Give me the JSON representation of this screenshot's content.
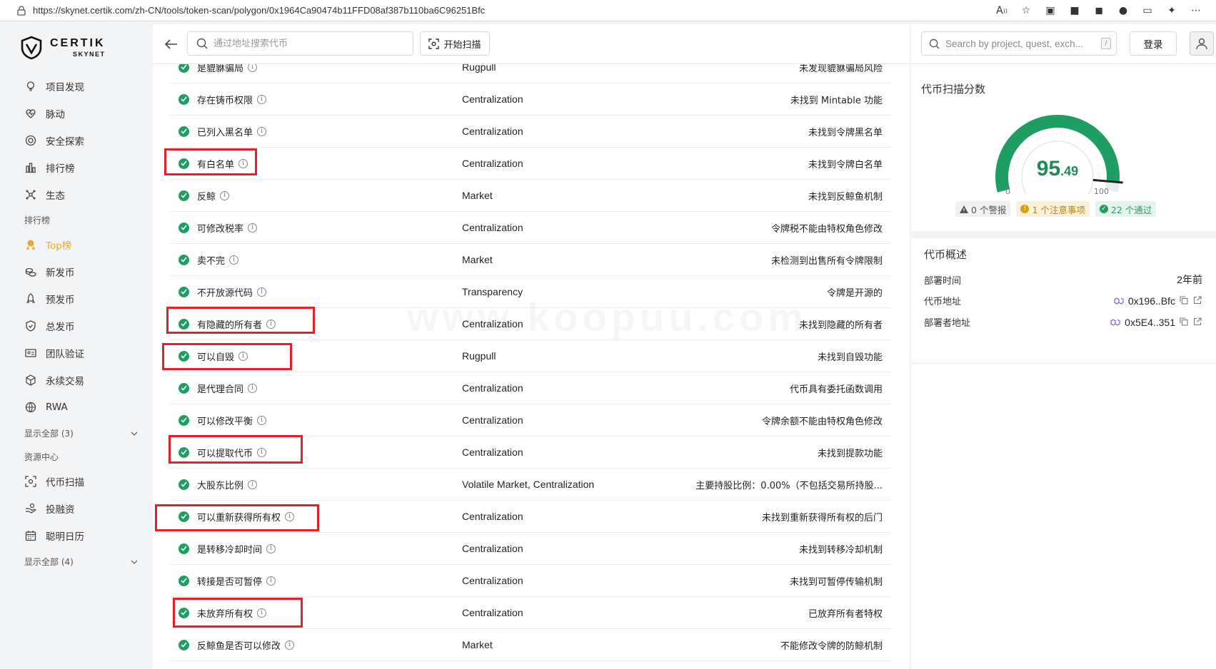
{
  "browser": {
    "url": "https://skynet.certik.com/zh-CN/tools/token-scan/polygon/0x1964Ca90474b11FFD08af387b110ba6C96251Bfc"
  },
  "brand": {
    "name": "CERTIK",
    "sub": "SKYNET"
  },
  "sidebar": {
    "items_main": [
      {
        "label": "项目发现",
        "icon": "bulb-icon"
      },
      {
        "label": "脉动",
        "icon": "heart-pulse-icon"
      },
      {
        "label": "安全探索",
        "icon": "target-icon"
      },
      {
        "label": "排行榜",
        "icon": "bar-chart-icon"
      },
      {
        "label": "生态",
        "icon": "network-icon"
      }
    ],
    "section_rank": "排行榜",
    "items_rank": [
      {
        "label": "Top榜",
        "icon": "medal-icon",
        "active": true
      },
      {
        "label": "新发币",
        "icon": "coins-icon"
      },
      {
        "label": "预发币",
        "icon": "rocket-icon"
      },
      {
        "label": "总发币",
        "icon": "shield-icon"
      },
      {
        "label": "团队验证",
        "icon": "id-card-icon"
      },
      {
        "label": "永续交易",
        "icon": "cube-icon"
      },
      {
        "label": "RWA",
        "icon": "globe-icon"
      }
    ],
    "show_all_1": "显示全部 (3)",
    "section_resource": "资源中心",
    "items_resource": [
      {
        "label": "代币扫描",
        "icon": "scan-icon"
      },
      {
        "label": "投融资",
        "icon": "invest-icon"
      },
      {
        "label": "聪明日历",
        "icon": "calendar-icon"
      }
    ],
    "show_all_2": "显示全部 (4)"
  },
  "topbar": {
    "search_placeholder": "通过地址搜索代币",
    "scan_label": "开始扫描"
  },
  "checks": [
    {
      "name": "是貔貅骗局",
      "category": "Rugpull",
      "result": "未发现貔貅骗局风险"
    },
    {
      "name": "存在铸币权限",
      "category": "Centralization",
      "result": "未找到 Mintable 功能"
    },
    {
      "name": "已列入黑名单",
      "category": "Centralization",
      "result": "未找到令牌黑名单"
    },
    {
      "name": "有白名单",
      "category": "Centralization",
      "result": "未找到令牌白名单"
    },
    {
      "name": "反鲸",
      "category": "Market",
      "result": "未找到反鲸鱼机制"
    },
    {
      "name": "可修改税率",
      "category": "Centralization",
      "result": "令牌税不能由特权角色修改"
    },
    {
      "name": "卖不完",
      "category": "Market",
      "result": "未检测到出售所有令牌限制"
    },
    {
      "name": "不开放源代码",
      "category": "Transparency",
      "result": "令牌是开源的"
    },
    {
      "name": "有隐藏的所有者",
      "category": "Centralization",
      "result": "未找到隐藏的所有者"
    },
    {
      "name": "可以自毁",
      "category": "Rugpull",
      "result": "未找到自毁功能"
    },
    {
      "name": "是代理合同",
      "category": "Centralization",
      "result": "代币具有委托函数调用"
    },
    {
      "name": "可以修改平衡",
      "category": "Centralization",
      "result": "令牌余额不能由特权角色修改"
    },
    {
      "name": "可以提取代币",
      "category": "Centralization",
      "result": "未找到提款功能"
    },
    {
      "name": "大股东比例",
      "category": "Volatile Market, Centralization",
      "result": "主要持股比例：0.00%（不包括交易所持股..."
    },
    {
      "name": "可以重新获得所有权",
      "category": "Centralization",
      "result": "未找到重新获得所有权的后门"
    },
    {
      "name": "是转移冷却时间",
      "category": "Centralization",
      "result": "未找到转移冷却机制"
    },
    {
      "name": "转接是否可暂停",
      "category": "Centralization",
      "result": "未找到可暂停传输机制"
    },
    {
      "name": "未放弃所有权",
      "category": "Centralization",
      "result": "已放弃所有者特权"
    },
    {
      "name": "反鲸鱼是否可以修改",
      "category": "Market",
      "result": "不能修改令牌的防鲸机制"
    }
  ],
  "right": {
    "search_placeholder": "Search by project, quest, exch...",
    "kbd": "/",
    "login": "登录",
    "score_title": "代币扫描分数",
    "score_int": "95",
    "score_dec": ".49",
    "score_value": 95.49,
    "gauge_min": "0",
    "gauge_max": "100",
    "badge_warn": "0 个警报",
    "badge_attention": "1 个注意事项",
    "badge_pass": "22 个通过",
    "overview_title": "代币概述",
    "deploy_time_label": "部署时间",
    "deploy_time_value": "2年前",
    "token_addr_label": "代币地址",
    "token_addr_value": "0x196..Bfc",
    "deployer_label": "部署者地址",
    "deployer_value": "0x5E4..351"
  },
  "watermark": "www.koopuu.com",
  "colors": {
    "pass": "#1e9e62",
    "accent": "#e8a92c",
    "highlight": "#e0202a"
  }
}
